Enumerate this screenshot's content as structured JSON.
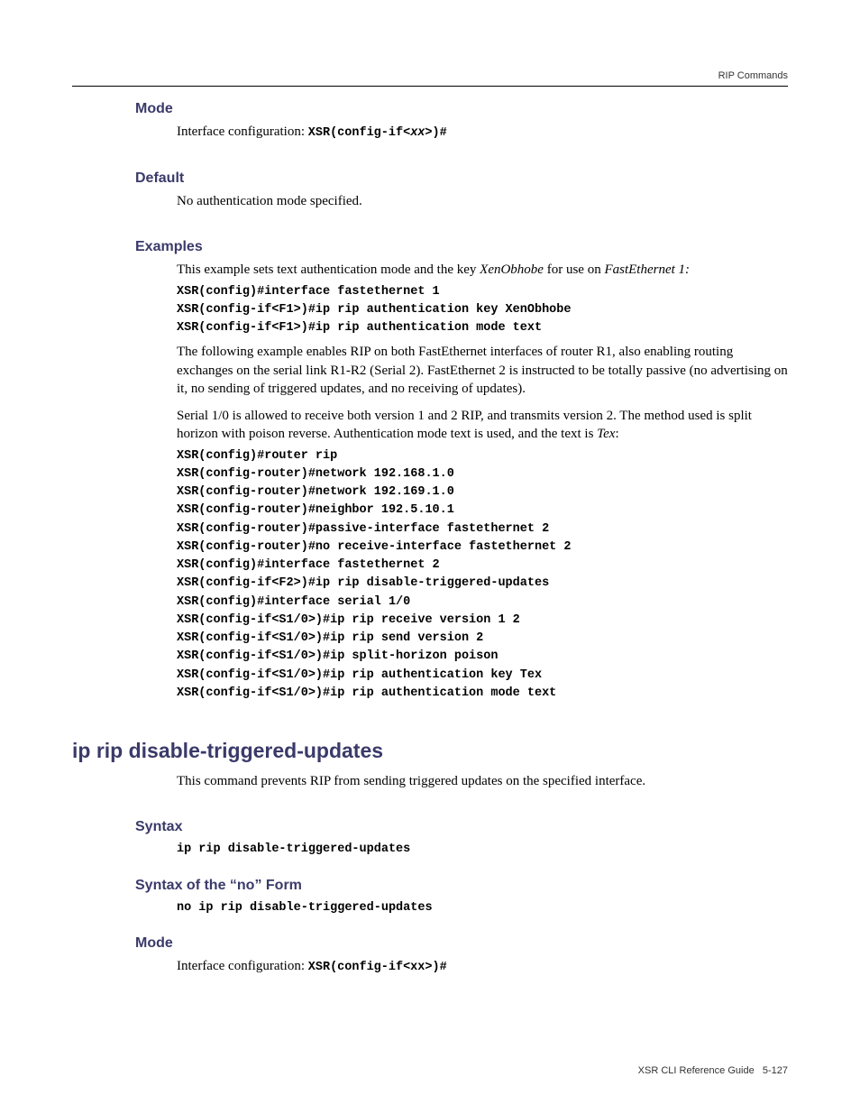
{
  "header": {
    "category": "RIP Commands"
  },
  "sections": {
    "mode1": {
      "heading": "Mode",
      "text_prefix": "Interface configuration: ",
      "code": "XSR(config-if<",
      "code_var": "xx",
      "code_suffix": ">)#"
    },
    "default": {
      "heading": "Default",
      "text": "No authentication mode specified."
    },
    "examples": {
      "heading": "Examples",
      "intro_prefix": "This example sets text authentication mode and the key ",
      "intro_key": "XenObhobe",
      "intro_mid": " for use on ",
      "intro_iface": "FastEthernet 1:",
      "code1": "XSR(config)#interface fastethernet 1\nXSR(config-if<F1>)#ip rip authentication key XenObhobe\nXSR(config-if<F1>)#ip rip authentication mode text",
      "para2": "The following example enables RIP on both FastEthernet interfaces of router R1, also enabling routing exchanges on the serial link R1-R2 (Serial 2). FastEthernet 2 is instructed to be totally passive (no advertising on it, no sending of triggered updates, and no receiving of updates).",
      "para3_prefix": "Serial 1/0 is allowed to receive both version 1 and 2 RIP, and transmits version 2. The method used is split horizon with poison reverse. Authentication mode text is used, and the text is ",
      "para3_em": "Tex",
      "para3_suffix": ":",
      "code2": "XSR(config)#router rip\nXSR(config-router)#network 192.168.1.0\nXSR(config-router)#network 192.169.1.0\nXSR(config-router)#neighbor 192.5.10.1\nXSR(config-router)#passive-interface fastethernet 2\nXSR(config-router)#no receive-interface fastethernet 2\nXSR(config)#interface fastethernet 2\nXSR(config-if<F2>)#ip rip disable-triggered-updates\nXSR(config)#interface serial 1/0\nXSR(config-if<S1/0>)#ip rip receive version 1 2\nXSR(config-if<S1/0>)#ip rip send version 2\nXSR(config-if<S1/0>)#ip split-horizon poison\nXSR(config-if<S1/0>)#ip rip authentication key Tex\nXSR(config-if<S1/0>)#ip rip authentication mode text"
    },
    "command": {
      "title": "ip rip disable-triggered-updates",
      "desc": "This command prevents RIP from sending triggered updates on the specified interface."
    },
    "syntax": {
      "heading": "Syntax",
      "code": "ip rip disable-triggered-updates"
    },
    "syntax_no": {
      "heading": "Syntax of the “no” Form",
      "code": "no ip rip disable-triggered-updates"
    },
    "mode2": {
      "heading": "Mode",
      "text_prefix": "Interface configuration:  ",
      "code": "XSR(config-if<xx>)#"
    }
  },
  "footer": {
    "doc": "XSR CLI Reference Guide",
    "page": "5-127"
  }
}
